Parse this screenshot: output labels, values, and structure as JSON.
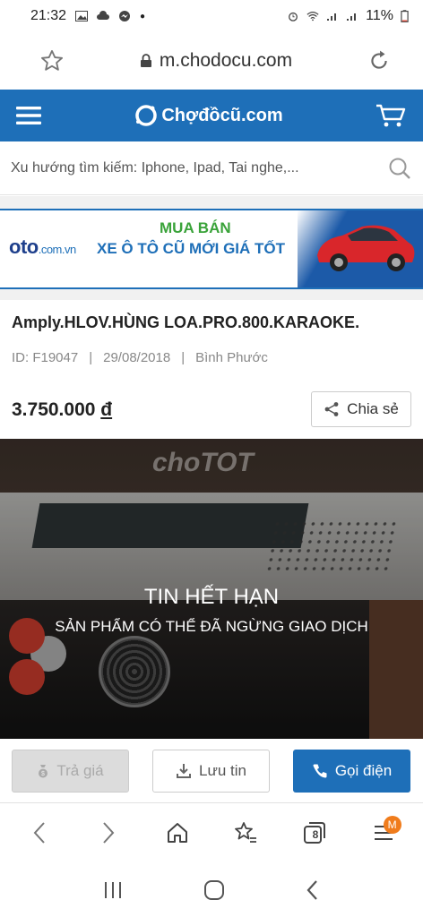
{
  "status_bar": {
    "time": "21:32",
    "battery": "11%"
  },
  "url_bar": {
    "url": "m.chodocu.com"
  },
  "site_header": {
    "logo_text": "Chợđồcũ.com"
  },
  "search": {
    "placeholder": "Xu hướng tìm kiếm: Iphone, Ipad, Tai nghe,..."
  },
  "banner": {
    "brand": "oto",
    "brand_suffix": ".com.vn",
    "line1": "MUA BÁN",
    "line2": "XE Ô TÔ CŨ MỚI GIÁ TỐT"
  },
  "product": {
    "title": "Amply.HLOV.HÙNG LOA.PRO.800.KARAOKE.",
    "id": "ID: F19047",
    "date": "29/08/2018",
    "location": "Bình Phước",
    "sep": "|",
    "price": "3.750.000",
    "currency": "đ",
    "share_label": "Chia sẻ"
  },
  "photo": {
    "watermark": "choTOT",
    "expired_title": "TIN HẾT HẠN",
    "expired_subtitle": "SẢN PHẨM CÓ THỂ ĐÃ NGỪNG GIAO DỊCH"
  },
  "actions": {
    "offer": "Trả giá",
    "save": "Lưu tin",
    "call": "Gọi điện"
  },
  "browser_nav": {
    "tabs_count": "8",
    "menu_badge": "M"
  },
  "colors": {
    "brand_blue": "#1e6fb8",
    "badge_orange": "#f07c1c"
  }
}
